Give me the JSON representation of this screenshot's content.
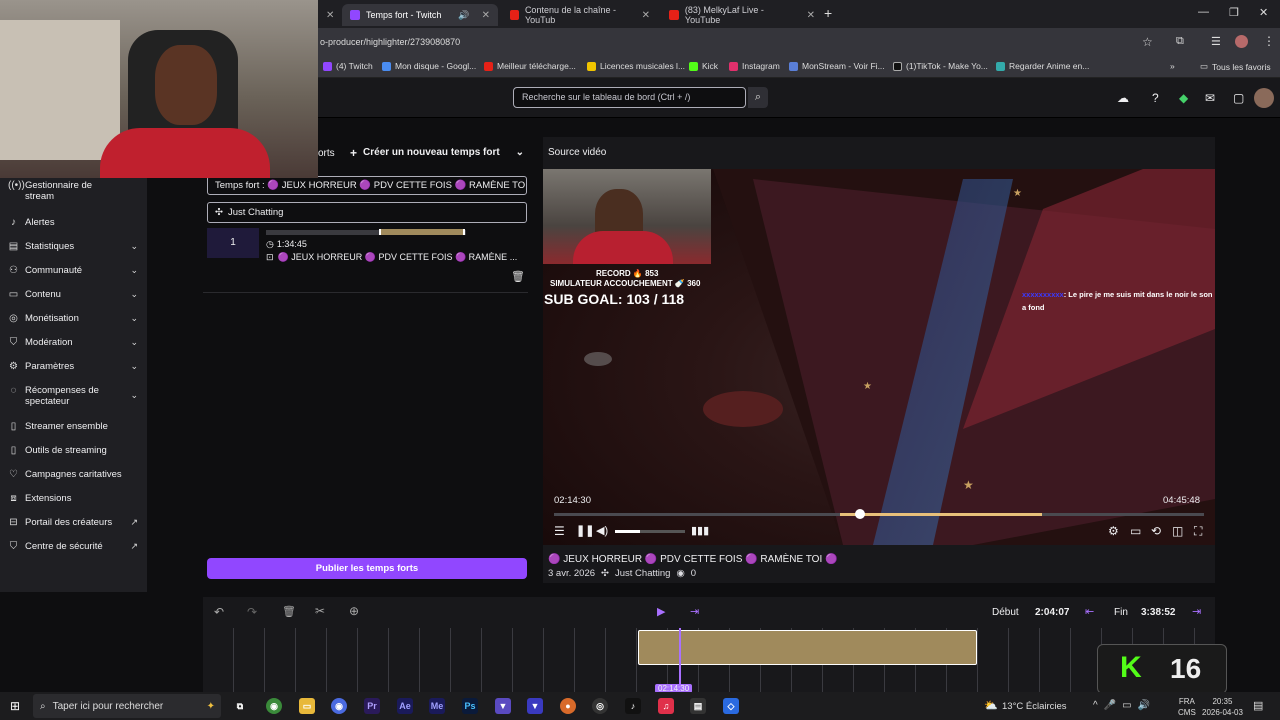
{
  "browser": {
    "tabs": [
      {
        "label": "Temps fort - Twitch",
        "active": true
      },
      {
        "label": "Contenu de la chaîne - YouTub"
      },
      {
        "label": "(83) MelkyLaf Live - YouTube"
      }
    ],
    "new_tab": "+",
    "url": "o-producer/highlighter/2739080870",
    "bookmarks": [
      "(4) Twitch",
      "Mon disque - Googl...",
      "Meilleur télécharge...",
      "Licences musicales l...",
      "Kick",
      "Instagram",
      "MonStream - Voir Fi...",
      "(1)TikTok - Make Yo...",
      "Regarder Anime en..."
    ],
    "bookmarks_more": "»",
    "favorites": "Tous les favoris"
  },
  "header": {
    "search_placeholder": "Recherche sur le tableau de bord (Ctrl + /)"
  },
  "sidebar": {
    "items": [
      {
        "label": "Gestionnaire de stream",
        "icon": "broadcast-icon"
      },
      {
        "label": "Alertes",
        "icon": "bell-icon"
      },
      {
        "label": "Statistiques",
        "icon": "stats-icon",
        "chev": true
      },
      {
        "label": "Communauté",
        "icon": "community-icon",
        "chev": true
      },
      {
        "label": "Contenu",
        "icon": "content-icon",
        "chev": true
      },
      {
        "label": "Monétisation",
        "icon": "money-icon",
        "chev": true
      },
      {
        "label": "Modération",
        "icon": "shield-icon",
        "chev": true
      },
      {
        "label": "Paramètres",
        "icon": "gear-icon",
        "chev": true
      },
      {
        "label": "Récompenses de spectateur",
        "icon": "reward-icon",
        "chev": true
      },
      {
        "label": "Streamer ensemble",
        "icon": "together-icon"
      },
      {
        "label": "Outils de streaming",
        "icon": "tools-icon"
      },
      {
        "label": "Campagnes caritatives",
        "icon": "heart-icon"
      },
      {
        "label": "Extensions",
        "icon": "extension-icon"
      },
      {
        "label": "Portail des créateurs",
        "icon": "portal-icon",
        "ext": true
      },
      {
        "label": "Centre de sécurité",
        "icon": "security-icon",
        "ext": true
      }
    ]
  },
  "highlights": {
    "crumb": "orts",
    "create_label": "Créer un nouveau temps fort",
    "title_field": "Temps fort : 🟣 JEUX HORREUR 🟣 PDV CETTE FOIS 🟣 RAMÈNE TOI",
    "category_field": "Just Chatting",
    "item": {
      "index": "1",
      "duration": "1:34:45",
      "title": "🟣 JEUX HORREUR 🟣 PDV CETTE FOIS 🟣 RAMÈNE ..."
    },
    "publish_label": "Publier les temps forts"
  },
  "video": {
    "section_label": "Source vidéo",
    "overlay_record": "RECORD 🔥 853",
    "overlay_game": "SIMULATEUR ACCOUCHEMENT 🍼 360",
    "overlay_goal": "SUB GOAL: 103 / 118",
    "chat_user": "xxxxxxxxxx",
    "chat_msg": ": Le pire je me suis mit dans le noir le son a fond",
    "time_current": "02:14:30",
    "time_total": "04:45:48",
    "progress": 0.47,
    "clip_start": 0.44,
    "clip_end": 0.75,
    "volume": 0.35,
    "title": "🟣 JEUX HORREUR 🟣 PDV CETTE FOIS 🟣 RAMÈNE TOI 🟣",
    "date": "3 avr. 2026",
    "category": "Just Chatting",
    "views": "0"
  },
  "timeline": {
    "start_label": "Début",
    "start_value": "2:04:07",
    "end_label": "Fin",
    "end_value": "3:38:52",
    "playhead": "02:14:30",
    "selection_start": 0.43,
    "selection_end": 0.765,
    "badge": "16"
  },
  "taskbar": {
    "search_placeholder": "Taper ici pour rechercher",
    "weather": "13°C  Éclaircies",
    "lang1": "FRA",
    "lang2": "CMS",
    "time": "20:35",
    "date": "2026-04-03"
  },
  "colors": {
    "accent": "#9147ff",
    "clip": "#a08a5c",
    "bg": "#0e0e10"
  }
}
